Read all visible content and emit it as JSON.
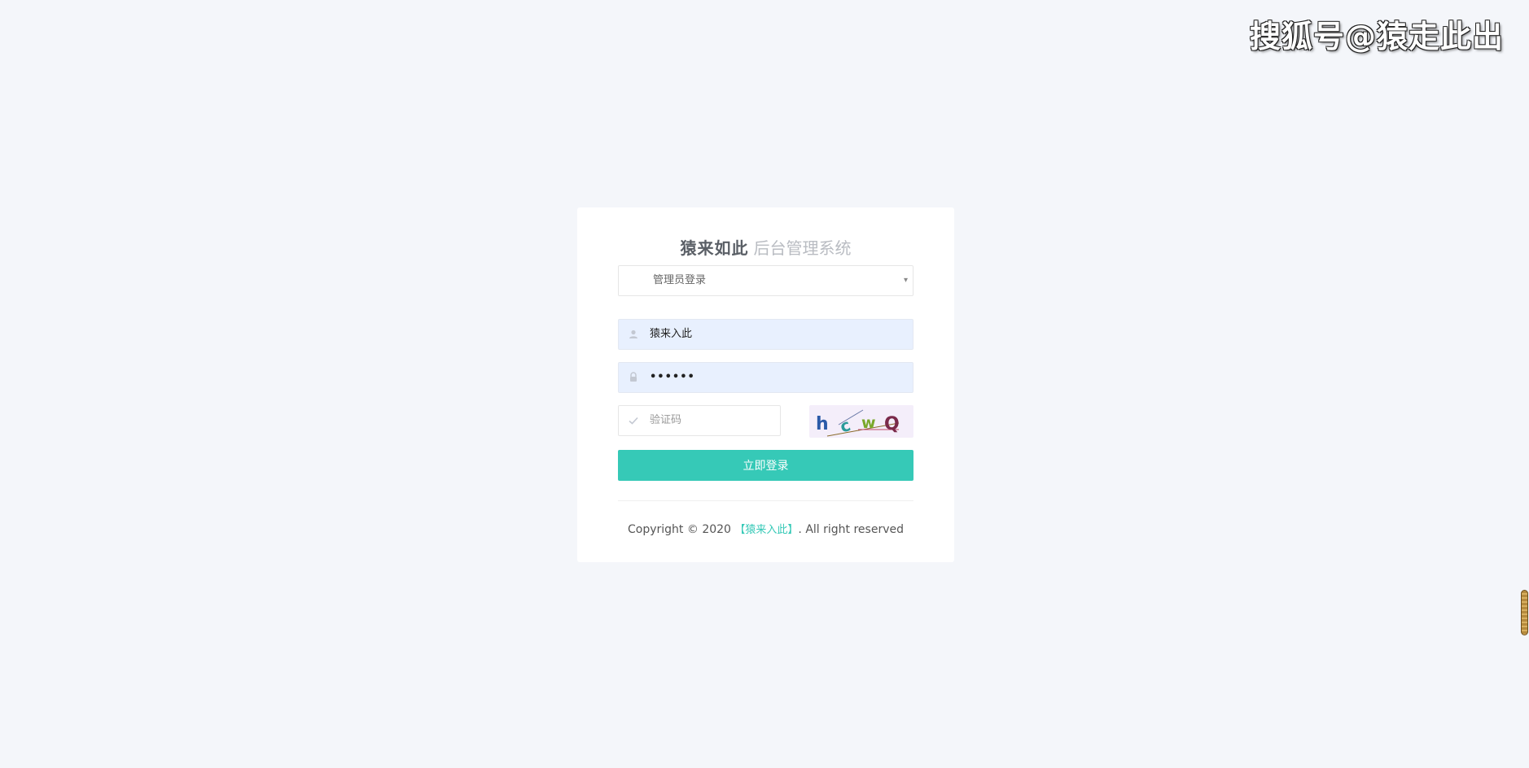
{
  "watermark": "搜狐号@猿走此出",
  "login": {
    "brand": "猿来如此",
    "subtitle": "后台管理系统",
    "role_select": {
      "selected": "管理员登录",
      "caret": "▾"
    },
    "username": {
      "value": "猿来入此"
    },
    "password": {
      "value": "••••••"
    },
    "captcha": {
      "placeholder": "验证码",
      "image_text": [
        "h",
        "c",
        "w",
        "Q"
      ]
    },
    "submit_label": "立即登录",
    "footer": {
      "prefix": "Copyright © 2020",
      "link": "【猿来入此】",
      "suffix": ". All right reserved"
    }
  },
  "colors": {
    "accent": "#36c9b7",
    "background": "#f4f6fa",
    "filled_input": "#e8f0fe"
  }
}
